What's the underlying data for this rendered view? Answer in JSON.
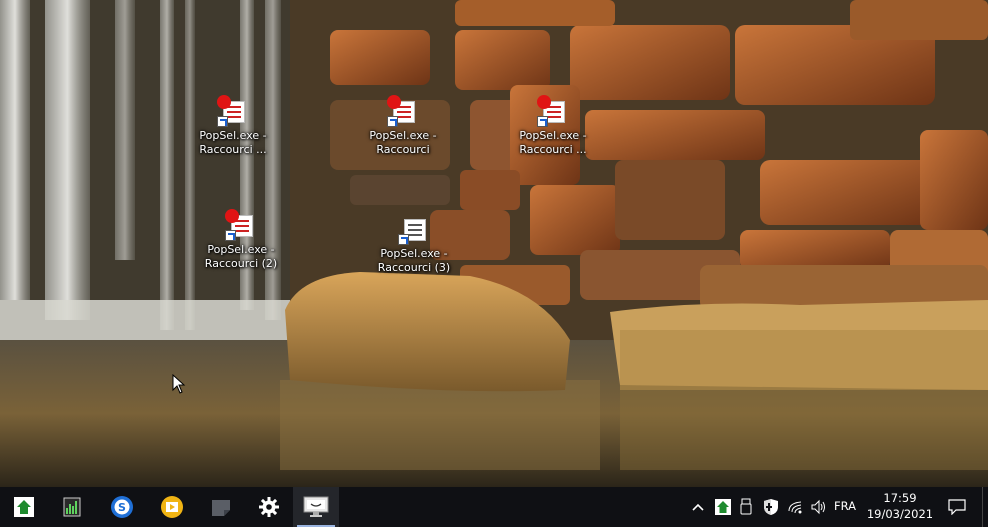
{
  "desktop": {
    "icons": [
      {
        "label": "PopSel.exe -\nRaccourci ...",
        "style": "red"
      },
      {
        "label": "PopSel.exe -\nRaccourci",
        "style": "red"
      },
      {
        "label": "PopSel.exe -\nRaccourci ...",
        "style": "red"
      },
      {
        "label": "PopSel.exe -\nRaccourci (2)",
        "style": "red"
      },
      {
        "label": "PopSel.exe -\nRaccourci (3)",
        "style": "plain"
      }
    ]
  },
  "taskbar": {
    "apps": [
      {
        "name": "app-green-house-icon"
      },
      {
        "name": "app-taskmanager-chart-icon"
      },
      {
        "name": "app-blue-s-icon"
      },
      {
        "name": "app-media-player-icon"
      },
      {
        "name": "app-sticky-note-icon"
      },
      {
        "name": "app-settings-gear-icon"
      },
      {
        "name": "app-monitor-icon",
        "active": true
      }
    ],
    "tray": {
      "language": "FRA",
      "time": "17:59",
      "date": "19/03/2021"
    }
  },
  "colors": {
    "taskbar_bg": "#0f1014",
    "active_indicator": "#9ab4e0",
    "shortcut_red": "#e01414"
  }
}
